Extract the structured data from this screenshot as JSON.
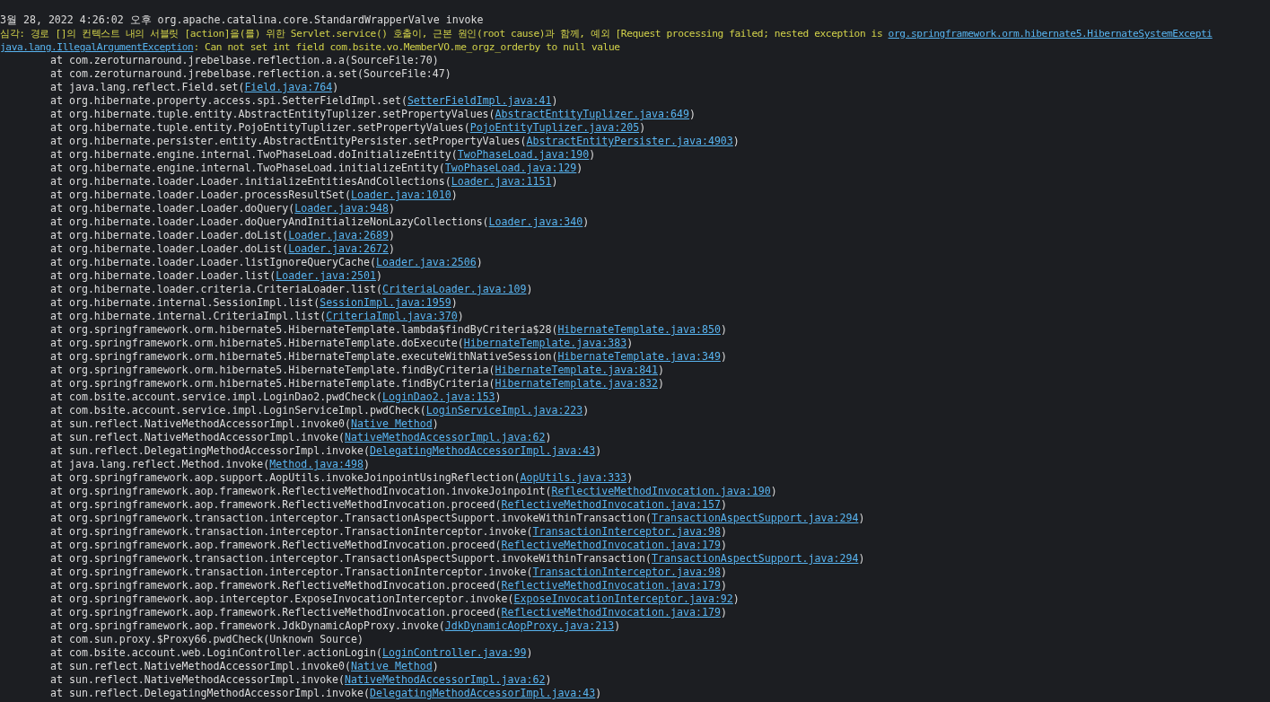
{
  "log": [
    {
      "kind": "header",
      "parts": [
        {
          "text": "3월 28, 2022 4:26:02 오후 org.apache.catalina.core.StandardWrapperValve invoke",
          "link": false
        }
      ]
    },
    {
      "kind": "message",
      "parts": [
        {
          "text": "심각: 경로 []의 컨텍스트 내의 서블릿 [action]을(를) 위한 Servlet.service() 호출이, 근본 원인(root cause)과 함께, 예외 [Request processing failed; nested exception is ",
          "link": false
        },
        {
          "text": "org.springframework.orm.hibernate5.HibernateSystemExcepti",
          "link": true
        }
      ]
    },
    {
      "kind": "message",
      "parts": [
        {
          "text": "java.lang.IllegalArgumentException",
          "link": true
        },
        {
          "text": ": Can not set int field com.bsite.vo.MemberVO.me_orgz_orderby to null value",
          "link": false
        }
      ]
    },
    {
      "kind": "frame",
      "parts": [
        {
          "text": "at com.zeroturnaround.jrebelbase.reflection.a.a(SourceFile:70)",
          "link": false
        }
      ]
    },
    {
      "kind": "frame",
      "parts": [
        {
          "text": "at com.zeroturnaround.jrebelbase.reflection.a.set(SourceFile:47)",
          "link": false
        }
      ]
    },
    {
      "kind": "frame",
      "parts": [
        {
          "text": "at java.lang.reflect.Field.set(",
          "link": false
        },
        {
          "text": "Field.java:764",
          "link": true
        },
        {
          "text": ")",
          "link": false
        }
      ]
    },
    {
      "kind": "frame",
      "parts": [
        {
          "text": "at org.hibernate.property.access.spi.SetterFieldImpl.set(",
          "link": false
        },
        {
          "text": "SetterFieldImpl.java:41",
          "link": true
        },
        {
          "text": ")",
          "link": false
        }
      ]
    },
    {
      "kind": "frame",
      "parts": [
        {
          "text": "at org.hibernate.tuple.entity.AbstractEntityTuplizer.setPropertyValues(",
          "link": false
        },
        {
          "text": "AbstractEntityTuplizer.java:649",
          "link": true
        },
        {
          "text": ")",
          "link": false
        }
      ]
    },
    {
      "kind": "frame",
      "parts": [
        {
          "text": "at org.hibernate.tuple.entity.PojoEntityTuplizer.setPropertyValues(",
          "link": false
        },
        {
          "text": "PojoEntityTuplizer.java:205",
          "link": true
        },
        {
          "text": ")",
          "link": false
        }
      ]
    },
    {
      "kind": "frame",
      "parts": [
        {
          "text": "at org.hibernate.persister.entity.AbstractEntityPersister.setPropertyValues(",
          "link": false
        },
        {
          "text": "AbstractEntityPersister.java:4903",
          "link": true
        },
        {
          "text": ")",
          "link": false
        }
      ]
    },
    {
      "kind": "frame",
      "parts": [
        {
          "text": "at org.hibernate.engine.internal.TwoPhaseLoad.doInitializeEntity(",
          "link": false
        },
        {
          "text": "TwoPhaseLoad.java:190",
          "link": true
        },
        {
          "text": ")",
          "link": false
        }
      ]
    },
    {
      "kind": "frame",
      "parts": [
        {
          "text": "at org.hibernate.engine.internal.TwoPhaseLoad.initializeEntity(",
          "link": false
        },
        {
          "text": "TwoPhaseLoad.java:129",
          "link": true
        },
        {
          "text": ")",
          "link": false
        }
      ]
    },
    {
      "kind": "frame",
      "parts": [
        {
          "text": "at org.hibernate.loader.Loader.initializeEntitiesAndCollections(",
          "link": false
        },
        {
          "text": "Loader.java:1151",
          "link": true
        },
        {
          "text": ")",
          "link": false
        }
      ]
    },
    {
      "kind": "frame",
      "parts": [
        {
          "text": "at org.hibernate.loader.Loader.processResultSet(",
          "link": false
        },
        {
          "text": "Loader.java:1010",
          "link": true
        },
        {
          "text": ")",
          "link": false
        }
      ]
    },
    {
      "kind": "frame",
      "parts": [
        {
          "text": "at org.hibernate.loader.Loader.doQuery(",
          "link": false
        },
        {
          "text": "Loader.java:948",
          "link": true
        },
        {
          "text": ")",
          "link": false
        }
      ]
    },
    {
      "kind": "frame",
      "parts": [
        {
          "text": "at org.hibernate.loader.Loader.doQueryAndInitializeNonLazyCollections(",
          "link": false
        },
        {
          "text": "Loader.java:340",
          "link": true
        },
        {
          "text": ")",
          "link": false
        }
      ]
    },
    {
      "kind": "frame",
      "parts": [
        {
          "text": "at org.hibernate.loader.Loader.doList(",
          "link": false
        },
        {
          "text": "Loader.java:2689",
          "link": true
        },
        {
          "text": ")",
          "link": false
        }
      ]
    },
    {
      "kind": "frame",
      "parts": [
        {
          "text": "at org.hibernate.loader.Loader.doList(",
          "link": false
        },
        {
          "text": "Loader.java:2672",
          "link": true
        },
        {
          "text": ")",
          "link": false
        }
      ]
    },
    {
      "kind": "frame",
      "parts": [
        {
          "text": "at org.hibernate.loader.Loader.listIgnoreQueryCache(",
          "link": false
        },
        {
          "text": "Loader.java:2506",
          "link": true
        },
        {
          "text": ")",
          "link": false
        }
      ]
    },
    {
      "kind": "frame",
      "parts": [
        {
          "text": "at org.hibernate.loader.Loader.list(",
          "link": false
        },
        {
          "text": "Loader.java:2501",
          "link": true
        },
        {
          "text": ")",
          "link": false
        }
      ]
    },
    {
      "kind": "frame",
      "parts": [
        {
          "text": "at org.hibernate.loader.criteria.CriteriaLoader.list(",
          "link": false
        },
        {
          "text": "CriteriaLoader.java:109",
          "link": true
        },
        {
          "text": ")",
          "link": false
        }
      ]
    },
    {
      "kind": "frame",
      "parts": [
        {
          "text": "at org.hibernate.internal.SessionImpl.list(",
          "link": false
        },
        {
          "text": "SessionImpl.java:1959",
          "link": true
        },
        {
          "text": ")",
          "link": false
        }
      ]
    },
    {
      "kind": "frame",
      "parts": [
        {
          "text": "at org.hibernate.internal.CriteriaImpl.list(",
          "link": false
        },
        {
          "text": "CriteriaImpl.java:370",
          "link": true
        },
        {
          "text": ")",
          "link": false
        }
      ]
    },
    {
      "kind": "frame",
      "parts": [
        {
          "text": "at org.springframework.orm.hibernate5.HibernateTemplate.lambda$findByCriteria$28(",
          "link": false
        },
        {
          "text": "HibernateTemplate.java:850",
          "link": true
        },
        {
          "text": ")",
          "link": false
        }
      ]
    },
    {
      "kind": "frame",
      "parts": [
        {
          "text": "at org.springframework.orm.hibernate5.HibernateTemplate.doExecute(",
          "link": false
        },
        {
          "text": "HibernateTemplate.java:383",
          "link": true
        },
        {
          "text": ")",
          "link": false
        }
      ]
    },
    {
      "kind": "frame",
      "parts": [
        {
          "text": "at org.springframework.orm.hibernate5.HibernateTemplate.executeWithNativeSession(",
          "link": false
        },
        {
          "text": "HibernateTemplate.java:349",
          "link": true
        },
        {
          "text": ")",
          "link": false
        }
      ]
    },
    {
      "kind": "frame",
      "parts": [
        {
          "text": "at org.springframework.orm.hibernate5.HibernateTemplate.findByCriteria(",
          "link": false
        },
        {
          "text": "HibernateTemplate.java:841",
          "link": true
        },
        {
          "text": ")",
          "link": false
        }
      ]
    },
    {
      "kind": "frame",
      "parts": [
        {
          "text": "at org.springframework.orm.hibernate5.HibernateTemplate.findByCriteria(",
          "link": false
        },
        {
          "text": "HibernateTemplate.java:832",
          "link": true
        },
        {
          "text": ")",
          "link": false
        }
      ]
    },
    {
      "kind": "frame",
      "parts": [
        {
          "text": "at com.bsite.account.service.impl.LoginDao2.pwdCheck(",
          "link": false
        },
        {
          "text": "LoginDao2.java:153",
          "link": true
        },
        {
          "text": ")",
          "link": false
        }
      ]
    },
    {
      "kind": "frame",
      "parts": [
        {
          "text": "at com.bsite.account.service.impl.LoginServiceImpl.pwdCheck(",
          "link": false
        },
        {
          "text": "LoginServiceImpl.java:223",
          "link": true
        },
        {
          "text": ")",
          "link": false
        }
      ]
    },
    {
      "kind": "frame",
      "parts": [
        {
          "text": "at sun.reflect.NativeMethodAccessorImpl.invoke0(",
          "link": false
        },
        {
          "text": "Native Method",
          "link": true
        },
        {
          "text": ")",
          "link": false
        }
      ]
    },
    {
      "kind": "frame",
      "parts": [
        {
          "text": "at sun.reflect.NativeMethodAccessorImpl.invoke(",
          "link": false
        },
        {
          "text": "NativeMethodAccessorImpl.java:62",
          "link": true
        },
        {
          "text": ")",
          "link": false
        }
      ]
    },
    {
      "kind": "frame",
      "parts": [
        {
          "text": "at sun.reflect.DelegatingMethodAccessorImpl.invoke(",
          "link": false
        },
        {
          "text": "DelegatingMethodAccessorImpl.java:43",
          "link": true
        },
        {
          "text": ")",
          "link": false
        }
      ]
    },
    {
      "kind": "frame",
      "parts": [
        {
          "text": "at java.lang.reflect.Method.invoke(",
          "link": false
        },
        {
          "text": "Method.java:498",
          "link": true
        },
        {
          "text": ")",
          "link": false
        }
      ]
    },
    {
      "kind": "frame",
      "parts": [
        {
          "text": "at org.springframework.aop.support.AopUtils.invokeJoinpointUsingReflection(",
          "link": false
        },
        {
          "text": "AopUtils.java:333",
          "link": true
        },
        {
          "text": ")",
          "link": false
        }
      ]
    },
    {
      "kind": "frame",
      "parts": [
        {
          "text": "at org.springframework.aop.framework.ReflectiveMethodInvocation.invokeJoinpoint(",
          "link": false
        },
        {
          "text": "ReflectiveMethodInvocation.java:190",
          "link": true
        },
        {
          "text": ")",
          "link": false
        }
      ]
    },
    {
      "kind": "frame",
      "parts": [
        {
          "text": "at org.springframework.aop.framework.ReflectiveMethodInvocation.proceed(",
          "link": false
        },
        {
          "text": "ReflectiveMethodInvocation.java:157",
          "link": true
        },
        {
          "text": ")",
          "link": false
        }
      ]
    },
    {
      "kind": "frame",
      "parts": [
        {
          "text": "at org.springframework.transaction.interceptor.TransactionAspectSupport.invokeWithinTransaction(",
          "link": false
        },
        {
          "text": "TransactionAspectSupport.java:294",
          "link": true
        },
        {
          "text": ")",
          "link": false
        }
      ]
    },
    {
      "kind": "frame",
      "parts": [
        {
          "text": "at org.springframework.transaction.interceptor.TransactionInterceptor.invoke(",
          "link": false
        },
        {
          "text": "TransactionInterceptor.java:98",
          "link": true
        },
        {
          "text": ")",
          "link": false
        }
      ]
    },
    {
      "kind": "frame",
      "parts": [
        {
          "text": "at org.springframework.aop.framework.ReflectiveMethodInvocation.proceed(",
          "link": false
        },
        {
          "text": "ReflectiveMethodInvocation.java:179",
          "link": true
        },
        {
          "text": ")",
          "link": false
        }
      ]
    },
    {
      "kind": "frame",
      "parts": [
        {
          "text": "at org.springframework.transaction.interceptor.TransactionAspectSupport.invokeWithinTransaction(",
          "link": false
        },
        {
          "text": "TransactionAspectSupport.java:294",
          "link": true
        },
        {
          "text": ")",
          "link": false
        }
      ]
    },
    {
      "kind": "frame",
      "parts": [
        {
          "text": "at org.springframework.transaction.interceptor.TransactionInterceptor.invoke(",
          "link": false
        },
        {
          "text": "TransactionInterceptor.java:98",
          "link": true
        },
        {
          "text": ")",
          "link": false
        }
      ]
    },
    {
      "kind": "frame",
      "parts": [
        {
          "text": "at org.springframework.aop.framework.ReflectiveMethodInvocation.proceed(",
          "link": false
        },
        {
          "text": "ReflectiveMethodInvocation.java:179",
          "link": true
        },
        {
          "text": ")",
          "link": false
        }
      ]
    },
    {
      "kind": "frame",
      "parts": [
        {
          "text": "at org.springframework.aop.interceptor.ExposeInvocationInterceptor.invoke(",
          "link": false
        },
        {
          "text": "ExposeInvocationInterceptor.java:92",
          "link": true
        },
        {
          "text": ")",
          "link": false
        }
      ]
    },
    {
      "kind": "frame",
      "parts": [
        {
          "text": "at org.springframework.aop.framework.ReflectiveMethodInvocation.proceed(",
          "link": false
        },
        {
          "text": "ReflectiveMethodInvocation.java:179",
          "link": true
        },
        {
          "text": ")",
          "link": false
        }
      ]
    },
    {
      "kind": "frame",
      "parts": [
        {
          "text": "at org.springframework.aop.framework.JdkDynamicAopProxy.invoke(",
          "link": false
        },
        {
          "text": "JdkDynamicAopProxy.java:213",
          "link": true
        },
        {
          "text": ")",
          "link": false
        }
      ]
    },
    {
      "kind": "frame",
      "parts": [
        {
          "text": "at com.sun.proxy.$Proxy66.pwdCheck(Unknown Source)",
          "link": false
        }
      ]
    },
    {
      "kind": "frame",
      "parts": [
        {
          "text": "at com.bsite.account.web.LoginController.actionLogin(",
          "link": false
        },
        {
          "text": "LoginController.java:99",
          "link": true
        },
        {
          "text": ")",
          "link": false
        }
      ]
    },
    {
      "kind": "frame",
      "parts": [
        {
          "text": "at sun.reflect.NativeMethodAccessorImpl.invoke0(",
          "link": false
        },
        {
          "text": "Native Method",
          "link": true
        },
        {
          "text": ")",
          "link": false
        }
      ]
    },
    {
      "kind": "frame",
      "parts": [
        {
          "text": "at sun.reflect.NativeMethodAccessorImpl.invoke(",
          "link": false
        },
        {
          "text": "NativeMethodAccessorImpl.java:62",
          "link": true
        },
        {
          "text": ")",
          "link": false
        }
      ]
    },
    {
      "kind": "frame",
      "parts": [
        {
          "text": "at sun.reflect.DelegatingMethodAccessorImpl.invoke(",
          "link": false
        },
        {
          "text": "DelegatingMethodAccessorImpl.java:43",
          "link": true
        },
        {
          "text": ")",
          "link": false
        }
      ]
    }
  ]
}
